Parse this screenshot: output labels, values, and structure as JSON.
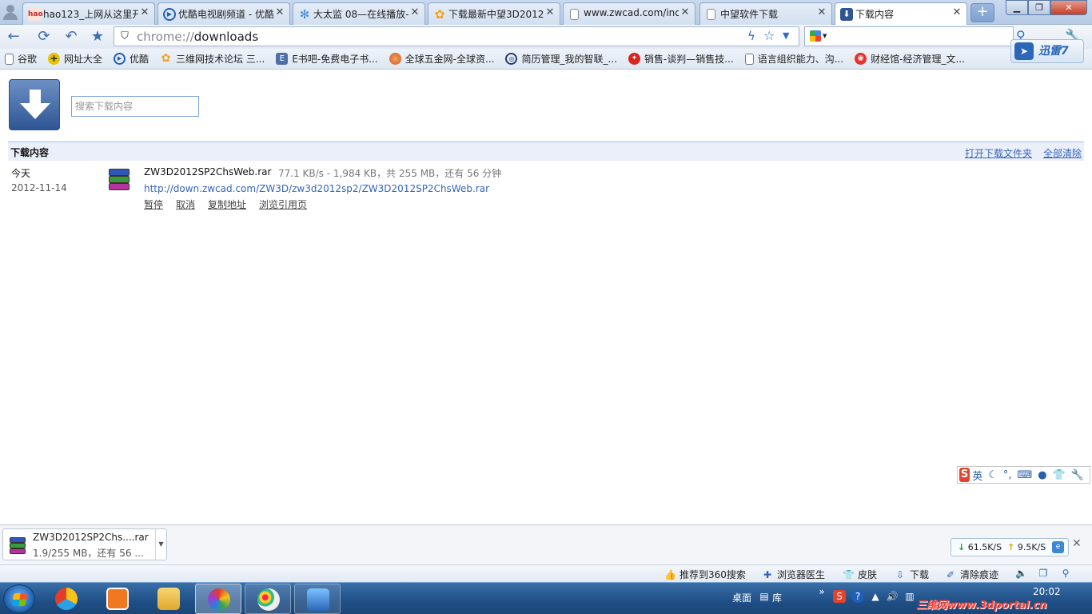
{
  "tabs": [
    {
      "label": "hao123_上网从这里开",
      "icon": "hao123-icon",
      "color": "#c1272d"
    },
    {
      "label": "优酷电视剧频道 - 优酷",
      "icon": "youku-icon",
      "color": "#1f5fb8"
    },
    {
      "label": "大太监 08—在线播放-",
      "icon": "gear-icon",
      "color": "#3b8ad8"
    },
    {
      "label": "下载最新中望3D2012",
      "icon": "flower-icon",
      "color": "#f0a020"
    },
    {
      "label": "www.zwcad.com/ind",
      "icon": "page-icon",
      "color": "#888888"
    },
    {
      "label": "中望软件下载",
      "icon": "page-icon",
      "color": "#888888"
    },
    {
      "label": "下载内容",
      "icon": "download-icon",
      "color": "#2f5694"
    }
  ],
  "toolbar": {
    "url_scheme": "chrome://",
    "url_path": "downloads"
  },
  "bookmarks": [
    {
      "label": "谷歌",
      "icon": "page-icon"
    },
    {
      "label": "网址大全",
      "icon": "plus-icon"
    },
    {
      "label": "优酷",
      "icon": "youku-icon"
    },
    {
      "label": "三维网技术论坛 三...",
      "icon": "flower-icon"
    },
    {
      "label": "E书吧-免费电子书...",
      "icon": "ebook-icon"
    },
    {
      "label": "全球五金网-全球资...",
      "icon": "globe-icon"
    },
    {
      "label": "简历管理_我的智联_...",
      "icon": "zhilian-icon"
    },
    {
      "label": "销售-谈判—销售技...",
      "icon": "sales-icon"
    },
    {
      "label": "语言组织能力、沟...",
      "icon": "page-icon"
    },
    {
      "label": "财经馆-经济管理_文...",
      "icon": "weibo-icon"
    }
  ],
  "xunlei": {
    "label": "迅雷7"
  },
  "downloads_page": {
    "search_placeholder": "搜索下载内容",
    "section_title": "下载内容",
    "open_folder": "打开下载文件夹",
    "clear_all": "全部清除",
    "date_label": "今天",
    "date_value": "2012-11-14",
    "file_name": "ZW3D2012SP2ChsWeb.rar",
    "status": "77.1 KB/s - 1,984 KB，共 255 MB，还有 56 分钟",
    "url": "http://down.zwcad.com/ZW3D/zw3d2012sp2/ZW3D2012SP2ChsWeb.rar",
    "actions": [
      "暂停",
      "取消",
      "复制地址",
      "浏览引用页"
    ]
  },
  "ime": {
    "mode": "英"
  },
  "shelf": {
    "item_name": "ZW3D2012SP2Chs....rar",
    "item_status": "1.9/255 MB，还有 56 ...",
    "down_speed": "61.5K/S",
    "up_speed": "9.5K/S"
  },
  "statusbar": [
    {
      "label": "推荐到360搜索",
      "icon": "thumb-icon"
    },
    {
      "label": "浏览器医生",
      "icon": "doctor-icon"
    },
    {
      "label": "皮肤",
      "icon": "shirt-icon"
    },
    {
      "label": "下载",
      "icon": "download-icon"
    },
    {
      "label": "清除痕迹",
      "icon": "broom-icon"
    }
  ],
  "taskbar": {
    "desktop_label": "桌面",
    "library_label": "库",
    "clock": "20:02",
    "watermark": "三维网www.3dportal.cn"
  }
}
